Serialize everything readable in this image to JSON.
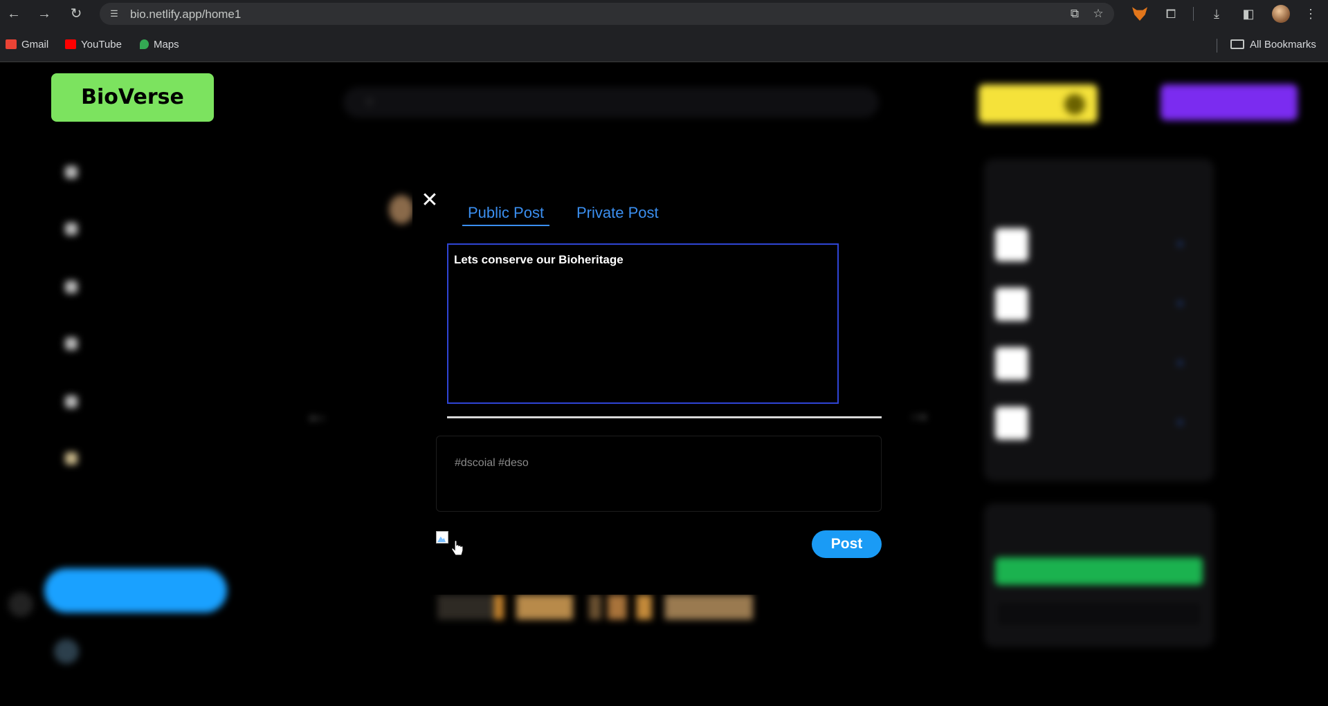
{
  "browser": {
    "url": "bio.netlify.app/home1",
    "bookmarks": [
      {
        "label": "Gmail",
        "icon": "gmail-icon",
        "color": "#ea4335"
      },
      {
        "label": "YouTube",
        "icon": "youtube-icon",
        "color": "#ff0000"
      },
      {
        "label": "Maps",
        "icon": "maps-icon",
        "color": "#34a853"
      }
    ],
    "all_bookmarks_label": "All Bookmarks"
  },
  "app": {
    "logo": "BioVerse",
    "logo_color": "#7ce35f"
  },
  "modal": {
    "tabs": [
      {
        "label": "Public Post",
        "active": true
      },
      {
        "label": "Private Post",
        "active": false
      }
    ],
    "post_text": "Lets conserve our Bioheritage",
    "hashtag_placeholder": "#dscoial #deso",
    "post_button": "Post",
    "accent_color": "#1a9bf5"
  }
}
